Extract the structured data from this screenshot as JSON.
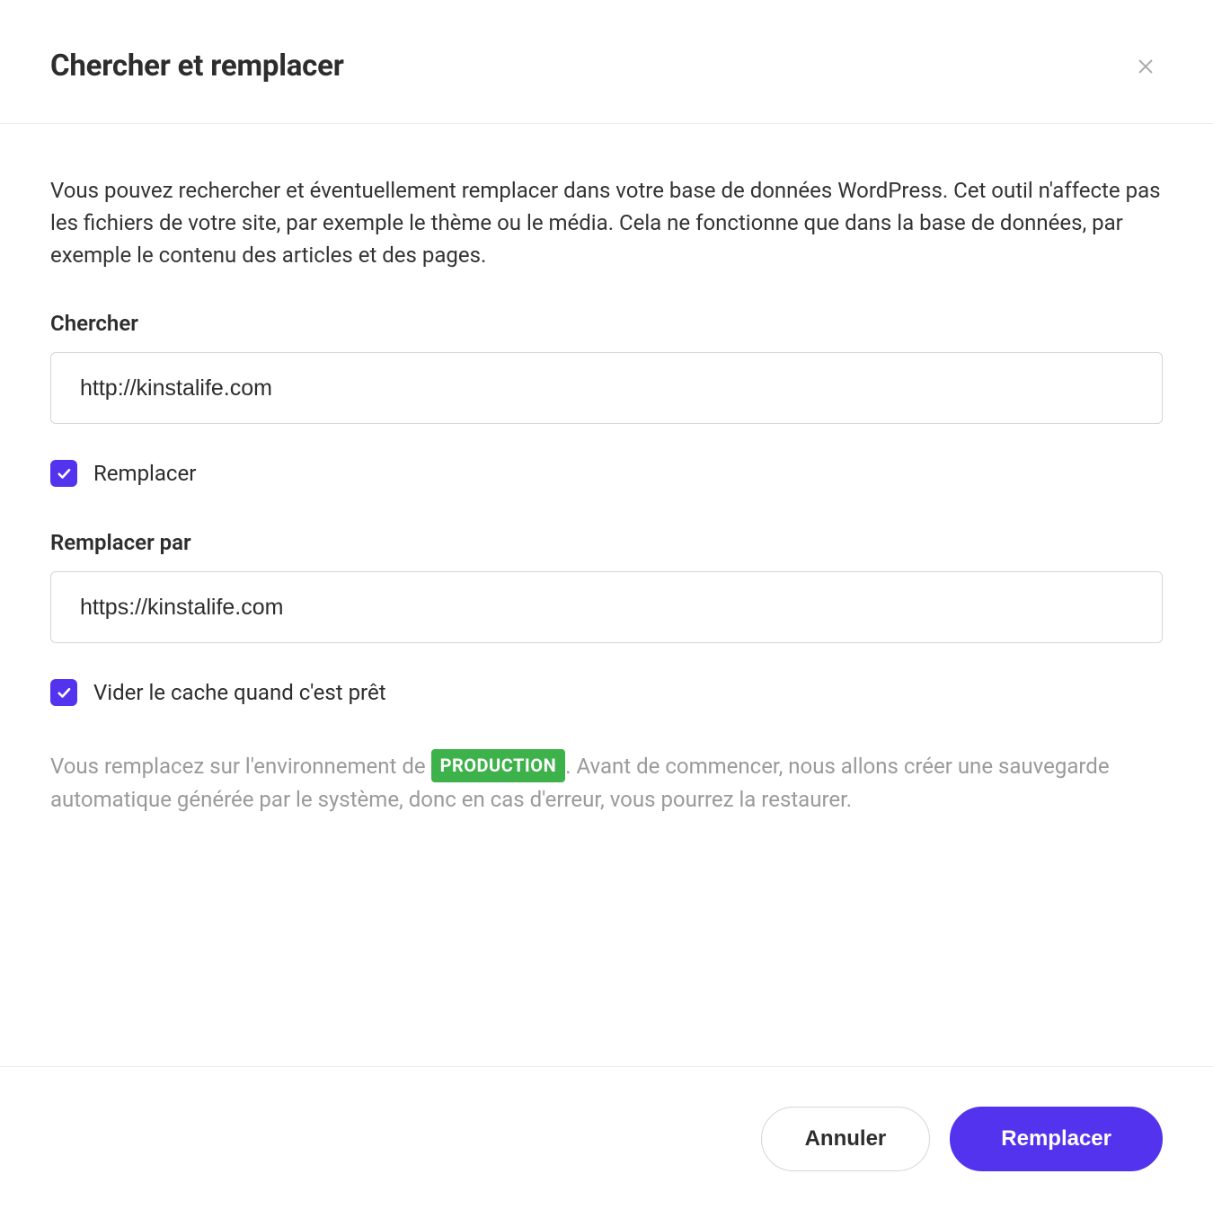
{
  "header": {
    "title": "Chercher et remplacer"
  },
  "body": {
    "description": "Vous pouvez rechercher et éventuellement remplacer dans votre base de données WordPress. Cet outil n'affecte pas les fichiers de votre site, par exemple le thème ou le média. Cela ne fonctionne que dans la base de données, par exemple le contenu des articles et des pages.",
    "search_label": "Chercher",
    "search_value": "http://kinstalife.com",
    "replace_checkbox_label": "Remplacer",
    "replace_with_label": "Remplacer par",
    "replace_with_value": "https://kinstalife.com",
    "clear_cache_label": "Vider le cache quand c'est prêt",
    "env_note_prefix": "Vous remplacez sur l'environnement de ",
    "env_badge": "PRODUCTION",
    "env_note_suffix": ". Avant de commencer, nous allons créer une sauvegarde automatique générée par le système, donc en cas d'erreur, vous pourrez la restaurer."
  },
  "footer": {
    "cancel_label": "Annuler",
    "submit_label": "Remplacer"
  }
}
